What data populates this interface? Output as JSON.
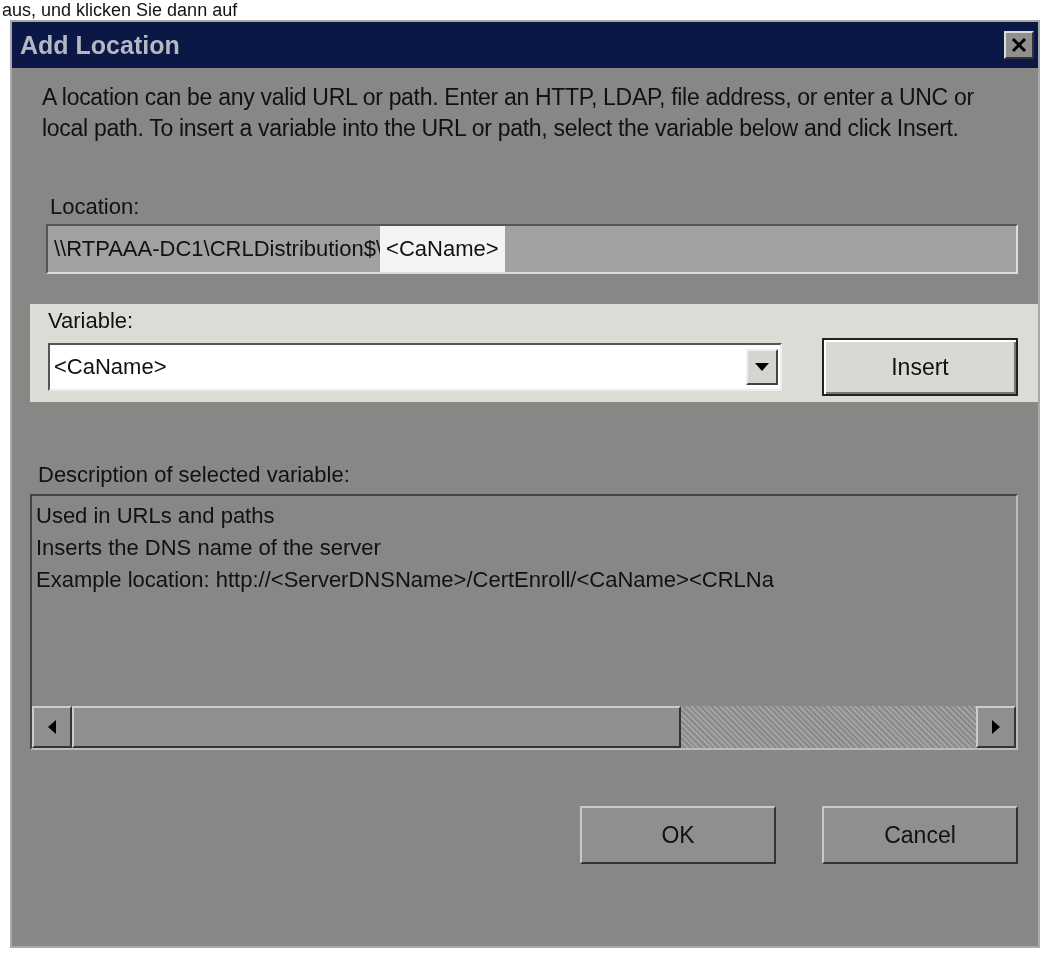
{
  "page_text": "aus, und klicken Sie dann auf",
  "window": {
    "title": "Add Location"
  },
  "intro": "A location can be any valid URL or path. Enter an HTTP, LDAP, file address, or enter a UNC or local path. To insert a variable into the URL or path, select the variable below and click Insert.",
  "location": {
    "label": "Location:",
    "value": [
      {
        "text": "\\\\RTPAAA-DC1\\CRLDistribution$\\",
        "highlighted": false
      },
      {
        "text": "<CaName>",
        "highlighted": true
      }
    ]
  },
  "variable": {
    "label": "Variable:",
    "value": "<CaName>",
    "highlighted": true,
    "button": "Insert"
  },
  "description": {
    "label": "Description of selected variable:",
    "lines": [
      "Used in URLs and paths",
      "Inserts the DNS name of the server",
      "Example location: http://<ServerDNSName>/CertEnroll/<CaName><CRLNa"
    ]
  },
  "buttons": [
    "OK",
    "Cancel"
  ]
}
